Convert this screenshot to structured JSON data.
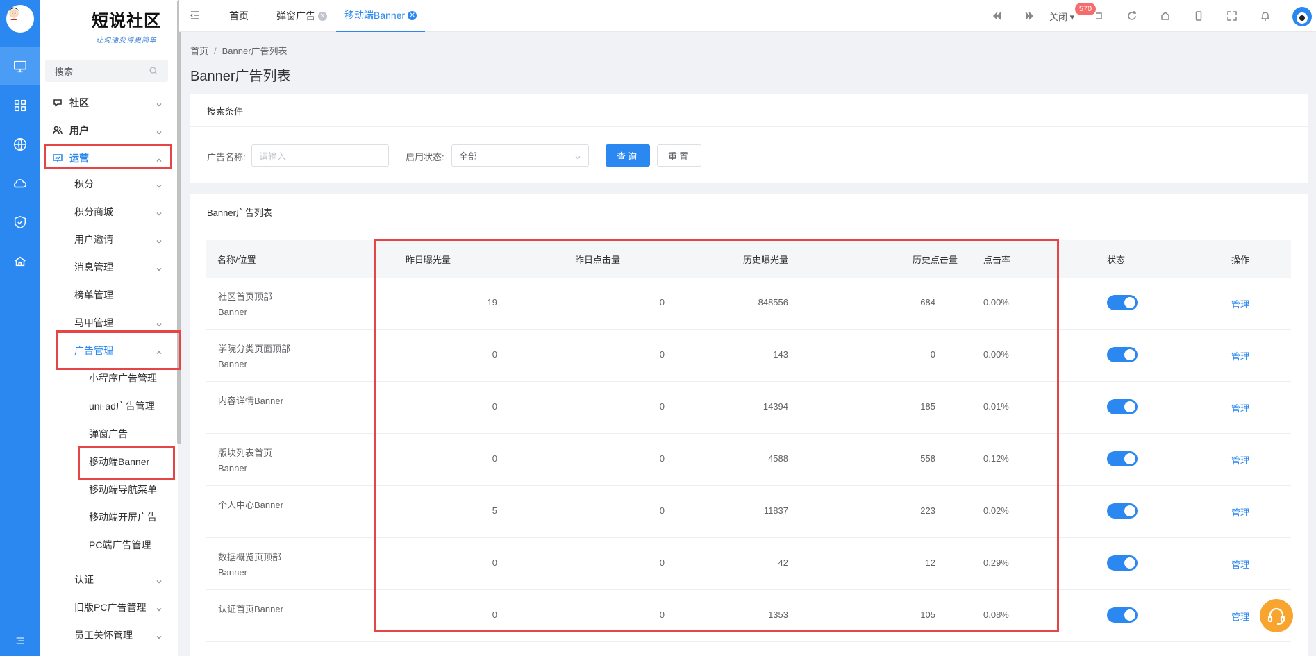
{
  "brand": {
    "title": "短说社区",
    "subtitle": "让沟通变得更简单"
  },
  "sidebar": {
    "search_placeholder": "搜索",
    "menu": {
      "community": "社区",
      "users": "用户",
      "operations": "运营",
      "points": "积分",
      "points_mall": "积分商城",
      "user_invite": "用户邀请",
      "message_mgmt": "消息管理",
      "rank_mgmt": "榜单管理",
      "vest_mgmt": "马甲管理",
      "ad_mgmt": "广告管理",
      "mini_ad": "小程序广告管理",
      "uniad": "uni-ad广告管理",
      "popup_ad": "弹窗广告",
      "mobile_banner": "移动端Banner",
      "mobile_nav": "移动端导航菜单",
      "mobile_splash": "移动端开屏广告",
      "pc_ad": "PC端广告管理",
      "verify": "认证",
      "old_pc_ad": "旧版PC广告管理",
      "staff_care": "员工关怀管理"
    }
  },
  "topbar": {
    "tabs": [
      "首页",
      "弹窗广告",
      "移动端Banner"
    ],
    "close_label": "关闭",
    "notification_count": "570"
  },
  "breadcrumb": {
    "home": "首页",
    "current": "Banner广告列表"
  },
  "page_title": "Banner广告列表",
  "search": {
    "section_title": "搜索条件",
    "ad_name_label": "广告名称:",
    "ad_name_placeholder": "请输入",
    "status_label": "启用状态:",
    "status_value": "全部",
    "query_button": "查询",
    "reset_button": "重置"
  },
  "list": {
    "section_title": "Banner广告列表",
    "columns": [
      "名称/位置",
      "昨日曝光量",
      "昨日点击量",
      "历史曝光量",
      "历史点击量",
      "点击率",
      "状态",
      "操作"
    ],
    "rows": [
      {
        "name": "社区首页顶部Banner",
        "y_exposure": "19",
        "y_click": "0",
        "h_exposure": "848556",
        "h_click": "684",
        "ctr": "0.00%",
        "enabled": true,
        "action": "管理"
      },
      {
        "name": "学院分类页面顶部Banner",
        "y_exposure": "0",
        "y_click": "0",
        "h_exposure": "143",
        "h_click": "0",
        "ctr": "0.00%",
        "enabled": true,
        "action": "管理"
      },
      {
        "name": "内容详情Banner",
        "y_exposure": "0",
        "y_click": "0",
        "h_exposure": "14394",
        "h_click": "185",
        "ctr": "0.01%",
        "enabled": true,
        "action": "管理"
      },
      {
        "name": "版块列表首页Banner",
        "y_exposure": "0",
        "y_click": "0",
        "h_exposure": "4588",
        "h_click": "558",
        "ctr": "0.12%",
        "enabled": true,
        "action": "管理"
      },
      {
        "name": "个人中心Banner",
        "y_exposure": "5",
        "y_click": "0",
        "h_exposure": "11837",
        "h_click": "223",
        "ctr": "0.02%",
        "enabled": true,
        "action": "管理"
      },
      {
        "name": "数据概览页顶部Banner",
        "y_exposure": "0",
        "y_click": "0",
        "h_exposure": "42",
        "h_click": "12",
        "ctr": "0.29%",
        "enabled": true,
        "action": "管理"
      },
      {
        "name": "认证首页Banner",
        "y_exposure": "0",
        "y_click": "0",
        "h_exposure": "1353",
        "h_click": "105",
        "ctr": "0.08%",
        "enabled": true,
        "action": "管理"
      }
    ]
  },
  "colors": {
    "primary": "#2b88f0",
    "highlight": "#e64545",
    "help": "#f7a52e"
  }
}
